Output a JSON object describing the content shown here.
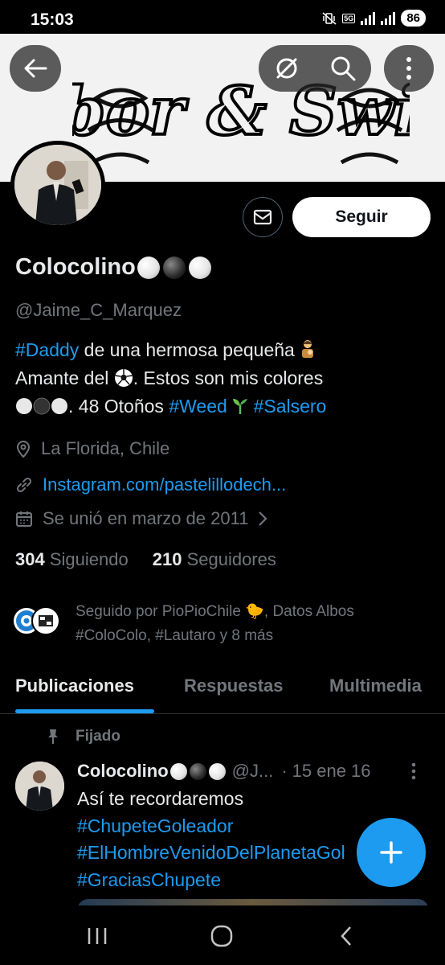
{
  "status_bar": {
    "time": "15:03",
    "network": "5G",
    "battery": "86",
    "icons": [
      "mute-vibrate-icon",
      "signal-icon",
      "battery-icon"
    ]
  },
  "header": {
    "banner_text": "Sabor & Swing",
    "buttons": [
      "back-arrow-icon",
      "hide-retweets-icon",
      "search-icon",
      "more-icon"
    ]
  },
  "actions": {
    "follow_label": "Seguir",
    "message_icon": "envelope-icon"
  },
  "profile": {
    "name": "Colocolino",
    "handle": "@Jaime_C_Marquez",
    "bio": {
      "tag_daddy": "#Daddy",
      "line1_rest": " de una hermosa pequeña",
      "line2": "Amante del",
      "line2_rest": ". Estos son mis colores",
      "line3_rest": ". 48 Otoños ",
      "tag_weed": "#Weed",
      "tag_salsero": "#Salsero"
    },
    "location": "La Florida, Chile",
    "website": "Instagram.com/pastelillodech...",
    "joined": "Se unió en marzo de 2011",
    "following_count": "304",
    "following_label": "Siguiendo",
    "followers_count": "210",
    "followers_label": "Seguidores",
    "followed_by": "Seguido por PioPioChile 🐤, Datos Albos #ColoColo, #Lautaro y 8 más"
  },
  "tabs": [
    {
      "label": "Publicaciones",
      "active": true
    },
    {
      "label": "Respuestas",
      "active": false
    },
    {
      "label": "Multimedia",
      "active": false
    }
  ],
  "pinned_post": {
    "pinned_label": "Fijado",
    "author_name": "Colocolino",
    "author_handle": "@J...",
    "separator": "·",
    "date": "15 ene 16",
    "line1": "Así te recordaremos",
    "line2": "#ChupeteGoleador",
    "line3": "#ElHombreVenidoDelPlanetaGol",
    "line4": "#GraciasChupete"
  },
  "colors": {
    "accent": "#1d9bf0",
    "text": "#e7e9ea",
    "muted": "#71767b",
    "background": "#000000"
  }
}
